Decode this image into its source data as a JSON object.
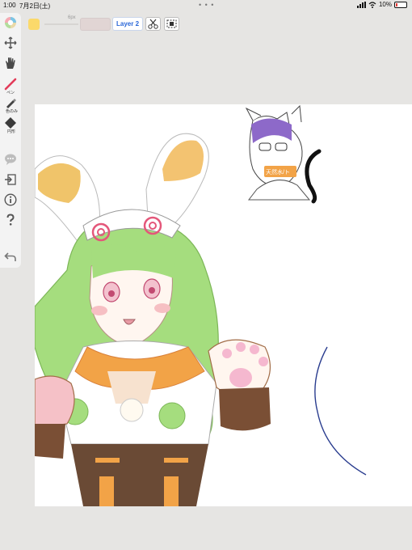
{
  "status": {
    "time": "1:00",
    "date": "7月2日(土)",
    "battery": "10%"
  },
  "toolbar": {
    "brush_size": "6px",
    "layer_label": "Layer 2",
    "colors": {
      "current": "#fbd96a",
      "accent": "#2a67d8",
      "opacity_box": "#e1d5d4"
    }
  },
  "sidebar": {
    "items": [
      {
        "name": "color-wheel-icon"
      },
      {
        "name": "move-icon"
      },
      {
        "name": "hand-icon"
      },
      {
        "name": "pen-tool",
        "label": "ペン"
      },
      {
        "name": "fill-tool",
        "label": "色のみ"
      },
      {
        "name": "eraser-tool",
        "label": "円形"
      },
      {
        "name": "chat-icon"
      },
      {
        "name": "export-icon"
      },
      {
        "name": "info-icon"
      },
      {
        "name": "help-icon"
      },
      {
        "name": "undo-icon"
      }
    ]
  },
  "canvas": {
    "sign_text": "天然水/ト"
  }
}
